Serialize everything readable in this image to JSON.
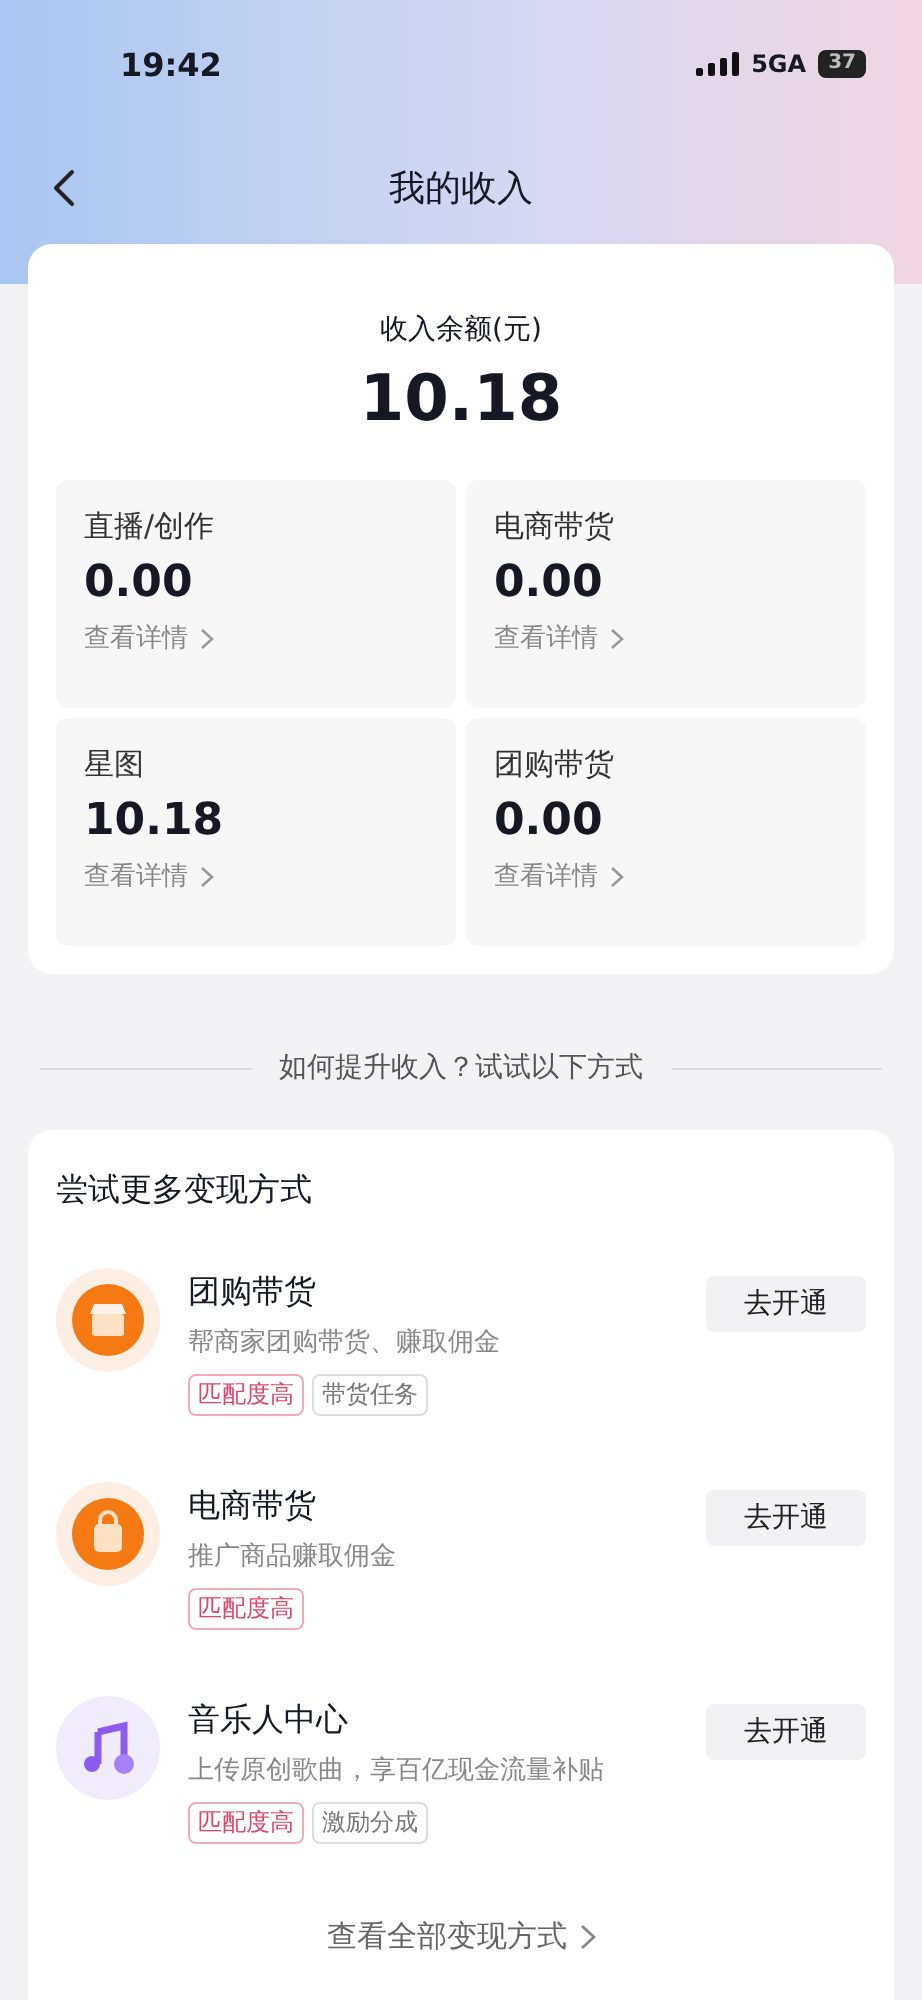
{
  "status_bar": {
    "time": "19:42",
    "network": "5GA",
    "battery": "37"
  },
  "nav": {
    "title": "我的收入"
  },
  "balance": {
    "label": "收入余额(元)",
    "amount": "10.18"
  },
  "breakdown": [
    {
      "name": "直播/创作",
      "amount": "0.00",
      "link": "查看详情"
    },
    {
      "name": "电商带货",
      "amount": "0.00",
      "link": "查看详情"
    },
    {
      "name": "星图",
      "amount": "10.18",
      "link": "查看详情"
    },
    {
      "name": "团购带货",
      "amount": "0.00",
      "link": "查看详情"
    }
  ],
  "tip": "如何提升收入？试试以下方式",
  "methods": {
    "title": "尝试更多变现方式",
    "items": [
      {
        "kind": "shop",
        "name": "团购带货",
        "desc": "帮商家团购带货、赚取佣金",
        "tags": [
          {
            "text": "匹配度高",
            "highlight": true
          },
          {
            "text": "带货任务",
            "highlight": false
          }
        ],
        "button": "去开通"
      },
      {
        "kind": "bag",
        "name": "电商带货",
        "desc": "推广商品赚取佣金",
        "tags": [
          {
            "text": "匹配度高",
            "highlight": true
          }
        ],
        "button": "去开通"
      },
      {
        "kind": "music",
        "name": "音乐人中心",
        "desc": "上传原创歌曲，享百亿现金流量补贴",
        "tags": [
          {
            "text": "匹配度高",
            "highlight": true
          },
          {
            "text": "激励分成",
            "highlight": false
          }
        ],
        "button": "去开通"
      }
    ],
    "more": "查看全部变现方式"
  }
}
